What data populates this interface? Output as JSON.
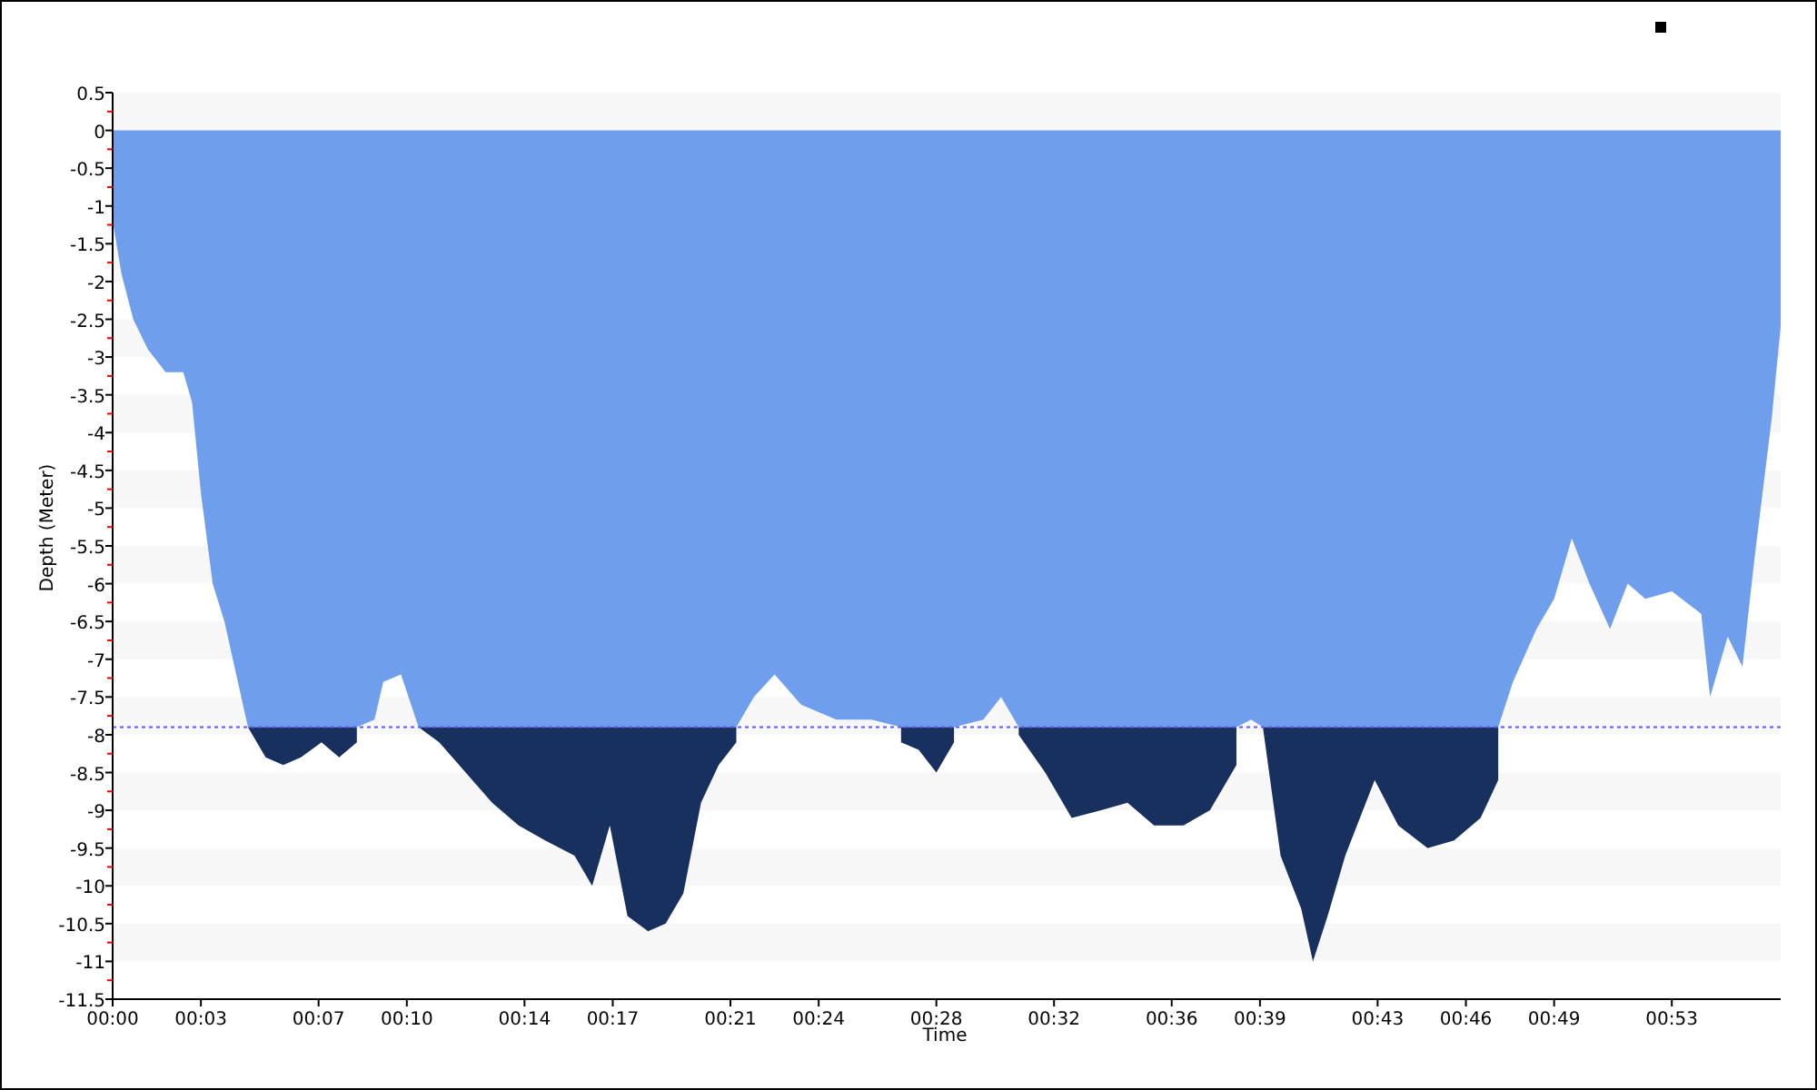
{
  "chart": {
    "chart_data": {
      "type": "area",
      "xlabel": "Time",
      "ylabel": "Depth (Meter)",
      "x": [
        0,
        0.3,
        0.7,
        1.2,
        1.8,
        2.4,
        2.7,
        3,
        3.4,
        3.8,
        4.2,
        4.6,
        5.2,
        5.8,
        6.4,
        7.1,
        7.7,
        8.3,
        8.9,
        9.2,
        9.8,
        10.4,
        11.1,
        12,
        12.9,
        13.8,
        14.7,
        15.7,
        16.3,
        16.9,
        17.5,
        18.2,
        18.8,
        19.4,
        20,
        20.6,
        21.2,
        21.8,
        22.5,
        23.4,
        24.6,
        25.8,
        26.8,
        27.4,
        28,
        28.6,
        29.6,
        30.2,
        30.8,
        31.7,
        32.6,
        33.6,
        34.5,
        35.4,
        36.4,
        37.3,
        38.2,
        38.7,
        39.1,
        39.7,
        40.4,
        40.8,
        41.3,
        41.9,
        42.9,
        43.7,
        44.7,
        45.6,
        46.5,
        47.1,
        47.6,
        48.4,
        49,
        49.6,
        50.2,
        50.9,
        51.5,
        52.1,
        53,
        54,
        54.3,
        54.9,
        55.4,
        55.8,
        56.4,
        56.7
      ],
      "series": [
        {
          "color": "#6f9fec",
          "values": [
            -1.2,
            -1.9,
            -2.5,
            -2.9,
            -3.2,
            -3.2,
            -3.6,
            -4.8,
            -6.0,
            -6.5,
            -7.2,
            -7.9,
            -7.9,
            -7.9,
            -7.9,
            -7.9,
            -7.9,
            -7.9,
            -7.8,
            -7.3,
            -7.2,
            -7.9,
            -7.9,
            -7.9,
            -7.9,
            -7.9,
            -7.9,
            -7.9,
            -7.9,
            -7.9,
            -7.9,
            -7.9,
            -7.9,
            -7.9,
            -7.9,
            -7.9,
            -7.9,
            -7.5,
            -7.2,
            -7.6,
            -7.8,
            -7.8,
            -7.9,
            -7.9,
            -7.9,
            -7.9,
            -7.8,
            -7.5,
            -7.9,
            -7.9,
            -7.9,
            -7.9,
            -7.9,
            -7.9,
            -7.9,
            -7.9,
            -7.9,
            -7.8,
            -7.9,
            -7.9,
            -7.9,
            -7.9,
            -7.9,
            -7.9,
            -7.9,
            -7.9,
            -7.9,
            -7.9,
            -7.9,
            -7.9,
            -7.3,
            -6.6,
            -6.2,
            -5.4,
            -6.0,
            -6.6,
            -6.0,
            -6.2,
            -6.1,
            -6.4,
            -7.5,
            -6.7,
            -7.1,
            -5.7,
            -3.8,
            -2.6
          ]
        },
        {
          "color": "#17305e",
          "values": [
            null,
            null,
            null,
            null,
            null,
            null,
            null,
            null,
            null,
            null,
            null,
            -7.9,
            -8.3,
            -8.4,
            -8.3,
            -8.1,
            -8.3,
            -8.1,
            null,
            null,
            null,
            -7.9,
            -8.1,
            -8.5,
            -8.9,
            -9.2,
            -9.4,
            -9.6,
            -10.0,
            -9.2,
            -10.4,
            -10.6,
            -10.5,
            -10.1,
            -8.9,
            -8.4,
            -8.1,
            null,
            null,
            null,
            null,
            null,
            -8.1,
            -8.2,
            -8.5,
            -8.1,
            null,
            null,
            -8.0,
            -8.5,
            -9.1,
            -9.0,
            -8.9,
            -9.2,
            -9.2,
            -9.0,
            -8.4,
            null,
            -7.9,
            -9.6,
            -10.3,
            -11.0,
            -10.4,
            -9.6,
            -8.6,
            -9.2,
            -9.5,
            -9.4,
            -9.1,
            -8.6,
            null,
            null,
            null,
            null,
            null,
            null,
            null,
            null,
            null,
            null,
            null,
            null,
            null,
            null,
            null,
            null
          ]
        }
      ],
      "xlim": [
        0,
        56.7
      ],
      "ylim": [
        -11.5,
        0.5
      ],
      "xticks": [
        {
          "value": 0,
          "label": "00:00"
        },
        {
          "value": 3,
          "label": "00:03"
        },
        {
          "value": 7,
          "label": "00:07"
        },
        {
          "value": 10,
          "label": "00:10"
        },
        {
          "value": 14,
          "label": "00:14"
        },
        {
          "value": 17,
          "label": "00:17"
        },
        {
          "value": 21,
          "label": "00:21"
        },
        {
          "value": 24,
          "label": "00:24"
        },
        {
          "value": 28,
          "label": "00:28"
        },
        {
          "value": 32,
          "label": "00:32"
        },
        {
          "value": 36,
          "label": "00:36"
        },
        {
          "value": 39,
          "label": "00:39"
        },
        {
          "value": 43,
          "label": "00:43"
        },
        {
          "value": 46,
          "label": "00:46"
        },
        {
          "value": 49,
          "label": "00:49"
        },
        {
          "value": 53,
          "label": "00:53"
        }
      ],
      "yticks": [
        0.5,
        0,
        -0.5,
        -1,
        -1.5,
        -2,
        -2.5,
        -3,
        -3.5,
        -4,
        -4.5,
        -5,
        -5.5,
        -6,
        -6.5,
        -7,
        -7.5,
        -8,
        -8.5,
        -9,
        -9.5,
        -10,
        -10.5,
        -11,
        -11.5
      ],
      "ref_lines": [
        {
          "axis": "y",
          "value": -7.9
        }
      ]
    }
  }
}
